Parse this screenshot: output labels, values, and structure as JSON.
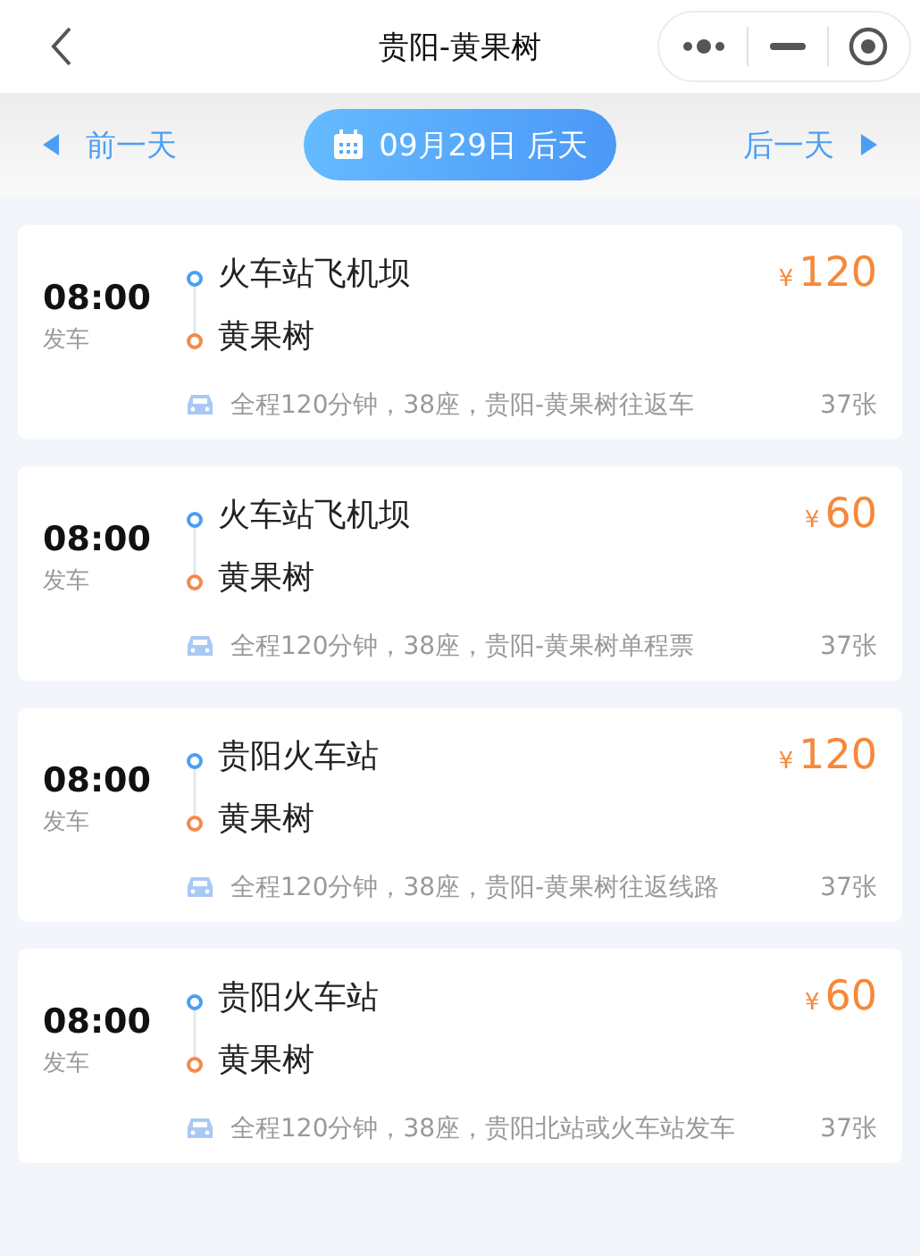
{
  "header": {
    "title": "贵阳-黄果树"
  },
  "date_bar": {
    "prev": "前一天",
    "date": "09月29日 后天",
    "next": "后一天"
  },
  "trips": [
    {
      "time": "08:00",
      "depart_label": "发车",
      "from": "火车站飞机坝",
      "to": "黄果树",
      "currency": "¥",
      "price": "120",
      "info": "全程120分钟，38座，贵阳-黄果树往返车",
      "tickets": "37张"
    },
    {
      "time": "08:00",
      "depart_label": "发车",
      "from": "火车站飞机坝",
      "to": "黄果树",
      "currency": "¥",
      "price": "60",
      "info": "全程120分钟，38座，贵阳-黄果树单程票",
      "tickets": "37张"
    },
    {
      "time": "08:00",
      "depart_label": "发车",
      "from": "贵阳火车站",
      "to": "黄果树",
      "currency": "¥",
      "price": "120",
      "info": "全程120分钟，38座，贵阳-黄果树往返线路",
      "tickets": "37张"
    },
    {
      "time": "08:00",
      "depart_label": "发车",
      "from": "贵阳火车站",
      "to": "黄果树",
      "currency": "¥",
      "price": "60",
      "info": "全程120分钟，38座，贵阳北站或火车站发车",
      "tickets": "37张"
    }
  ]
}
